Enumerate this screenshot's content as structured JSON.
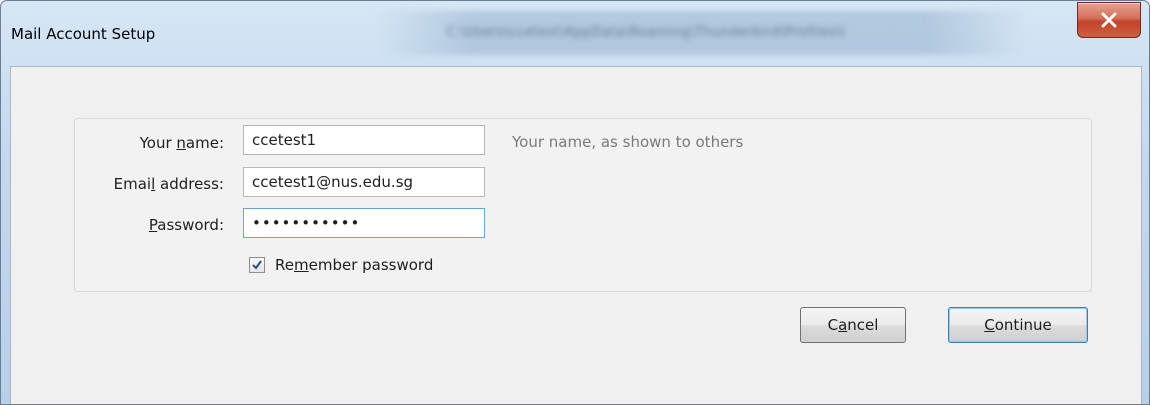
{
  "window": {
    "title": "Mail Account Setup",
    "title_path": "C:\\Users\\ccetest\\AppData\\Roaming\\Thunderbird\\Profiles\\l",
    "close_label": "Close"
  },
  "form": {
    "name_label_pre": "Your ",
    "name_label_key": "n",
    "name_label_post": "ame:",
    "name_value": "ccetest1",
    "name_hint": "Your name, as shown to others",
    "email_label_pre": "Emai",
    "email_label_key": "l",
    "email_label_post": " address:",
    "email_value": "ccetest1@nus.edu.sg",
    "password_label_pre": "",
    "password_label_key": "P",
    "password_label_post": "assword:",
    "password_value": "•••••••••••",
    "remember_pre": "Re",
    "remember_key": "m",
    "remember_post": "ember password",
    "remember_checked": true
  },
  "buttons": {
    "cancel_pre": "C",
    "cancel_key": "a",
    "cancel_post": "ncel",
    "continue_pre": "",
    "continue_key": "C",
    "continue_post": "ontinue"
  }
}
